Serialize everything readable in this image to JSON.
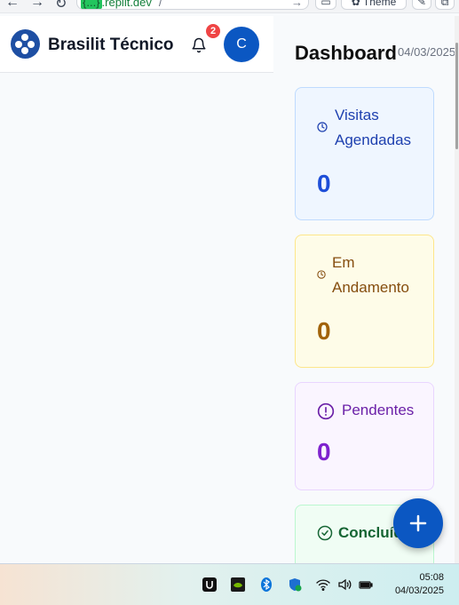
{
  "browser": {
    "url_host": "{...}",
    "url_domain": ".replit.dev",
    "url_path": "/",
    "theme_label": "Theme"
  },
  "header": {
    "brand": "Brasilit Técnico",
    "notification_count": "2",
    "avatar_initial": "C"
  },
  "dashboard": {
    "title": "Dashboard",
    "date": "04/03/2025"
  },
  "cards": [
    {
      "label": "Visitas Agendadas",
      "value": "0",
      "color": "#1d4ed8"
    },
    {
      "label": "Em Andamento",
      "value": "0",
      "color": "#a16207"
    },
    {
      "label": "Pendentes",
      "value": "0",
      "color": "#7e22ce"
    },
    {
      "label": "Concluídas",
      "color": "#166534"
    }
  ],
  "taskbar": {
    "time": "05:08",
    "date": "04/03/2025"
  },
  "colors": {
    "primary": "#0b57c2",
    "badge": "#ef4444"
  }
}
